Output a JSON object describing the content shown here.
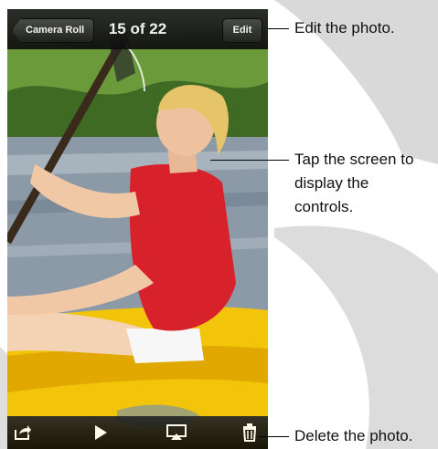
{
  "nav": {
    "back_label": "Camera Roll",
    "title": "15 of 22",
    "edit_label": "Edit"
  },
  "toolbar": {
    "share_icon": "share-icon",
    "play_icon": "play-icon",
    "airplay_icon": "airplay-icon",
    "trash_icon": "trash-icon"
  },
  "callouts": {
    "edit": "Edit the photo.",
    "tap_line1": "Tap the screen to",
    "tap_line2": "display the",
    "tap_line3": "controls.",
    "delete": "Delete the photo."
  },
  "colors": {
    "bar": "#111111",
    "kayak": "#f2c40a",
    "shirt": "#d8222b"
  }
}
